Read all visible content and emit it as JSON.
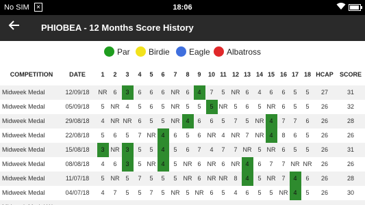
{
  "status_bar": {
    "carrier": "No SIM",
    "sim_icon": "sim-card-icon",
    "time": "18:06",
    "wifi_icon": "wifi-icon",
    "battery_icon": "battery-icon",
    "battery_level": 0.9
  },
  "app_bar": {
    "back_icon": "arrow-left-icon",
    "title": "PHIOBEA - 12 Months Score History"
  },
  "legend": [
    {
      "label": "Par",
      "color": "#1f9d1f"
    },
    {
      "label": "Birdie",
      "color": "#f2e21c"
    },
    {
      "label": "Eagle",
      "color": "#3f6fde"
    },
    {
      "label": "Albatross",
      "color": "#e0282a"
    }
  ],
  "table": {
    "headers": [
      "COMPETITION",
      "DATE",
      "1",
      "2",
      "3",
      "4",
      "5",
      "6",
      "7",
      "8",
      "9",
      "10",
      "11",
      "12",
      "13",
      "14",
      "15",
      "16",
      "17",
      "18",
      "HCAP",
      "SCORE"
    ],
    "par_color": "#2e8b2e",
    "rows": [
      {
        "competition": "Midweek Medal",
        "date": "12/09/18",
        "holes": [
          "NR",
          "6",
          "3",
          "6",
          "6",
          "6",
          "NR",
          "6",
          "4",
          "7",
          "5",
          "NR",
          "6",
          "4",
          "6",
          "6",
          "5",
          "5"
        ],
        "par_holes": [
          3,
          9
        ],
        "hcap": "27",
        "score": "31"
      },
      {
        "competition": "Midweek Medal",
        "date": "05/09/18",
        "holes": [
          "5",
          "NR",
          "4",
          "5",
          "6",
          "5",
          "NR",
          "5",
          "5",
          "5",
          "NR",
          "5",
          "6",
          "5",
          "NR",
          "6",
          "5",
          "5"
        ],
        "par_holes": [
          10
        ],
        "hcap": "26",
        "score": "32"
      },
      {
        "competition": "Midweek Medal",
        "date": "29/08/18",
        "holes": [
          "4",
          "NR",
          "NR",
          "6",
          "5",
          "5",
          "NR",
          "4",
          "6",
          "6",
          "5",
          "7",
          "5",
          "NR",
          "4",
          "7",
          "7",
          "6"
        ],
        "par_holes": [
          8,
          15
        ],
        "hcap": "26",
        "score": "28"
      },
      {
        "competition": "Midweek Medal",
        "date": "22/08/18",
        "holes": [
          "5",
          "6",
          "5",
          "7",
          "NR",
          "4",
          "6",
          "5",
          "6",
          "NR",
          "4",
          "NR",
          "7",
          "NR",
          "4",
          "8",
          "6",
          "5"
        ],
        "par_holes": [
          6,
          15
        ],
        "hcap": "26",
        "score": "26"
      },
      {
        "competition": "Midweek Medal",
        "date": "15/08/18",
        "holes": [
          "3",
          "NR",
          "3",
          "5",
          "5",
          "4",
          "5",
          "6",
          "7",
          "4",
          "7",
          "7",
          "NR",
          "5",
          "NR",
          "6",
          "5",
          "5"
        ],
        "par_holes": [
          1,
          3,
          6
        ],
        "hcap": "26",
        "score": "31"
      },
      {
        "competition": "Midweek Medal",
        "date": "08/08/18",
        "holes": [
          "4",
          "6",
          "3",
          "5",
          "NR",
          "4",
          "5",
          "NR",
          "6",
          "NR",
          "6",
          "NR",
          "4",
          "6",
          "7",
          "7",
          "NR",
          "NR"
        ],
        "par_holes": [
          3,
          6,
          13
        ],
        "hcap": "26",
        "score": "26"
      },
      {
        "competition": "Midweek Medal",
        "date": "11/07/18",
        "holes": [
          "5",
          "NR",
          "5",
          "7",
          "5",
          "5",
          "5",
          "NR",
          "6",
          "NR",
          "NR",
          "8",
          "4",
          "5",
          "NR",
          "7",
          "4",
          "6"
        ],
        "par_holes": [
          13,
          17
        ],
        "hcap": "26",
        "score": "28"
      },
      {
        "competition": "Midweek Medal",
        "date": "04/07/18",
        "holes": [
          "4",
          "7",
          "5",
          "5",
          "7",
          "5",
          "NR",
          "5",
          "NR",
          "6",
          "5",
          "4",
          "6",
          "5",
          "5",
          "NR",
          "4",
          "5"
        ],
        "par_holes": [
          17
        ],
        "hcap": "26",
        "score": "30"
      }
    ],
    "partial_row": {
      "competition": "Midweek Medal W"
    }
  }
}
